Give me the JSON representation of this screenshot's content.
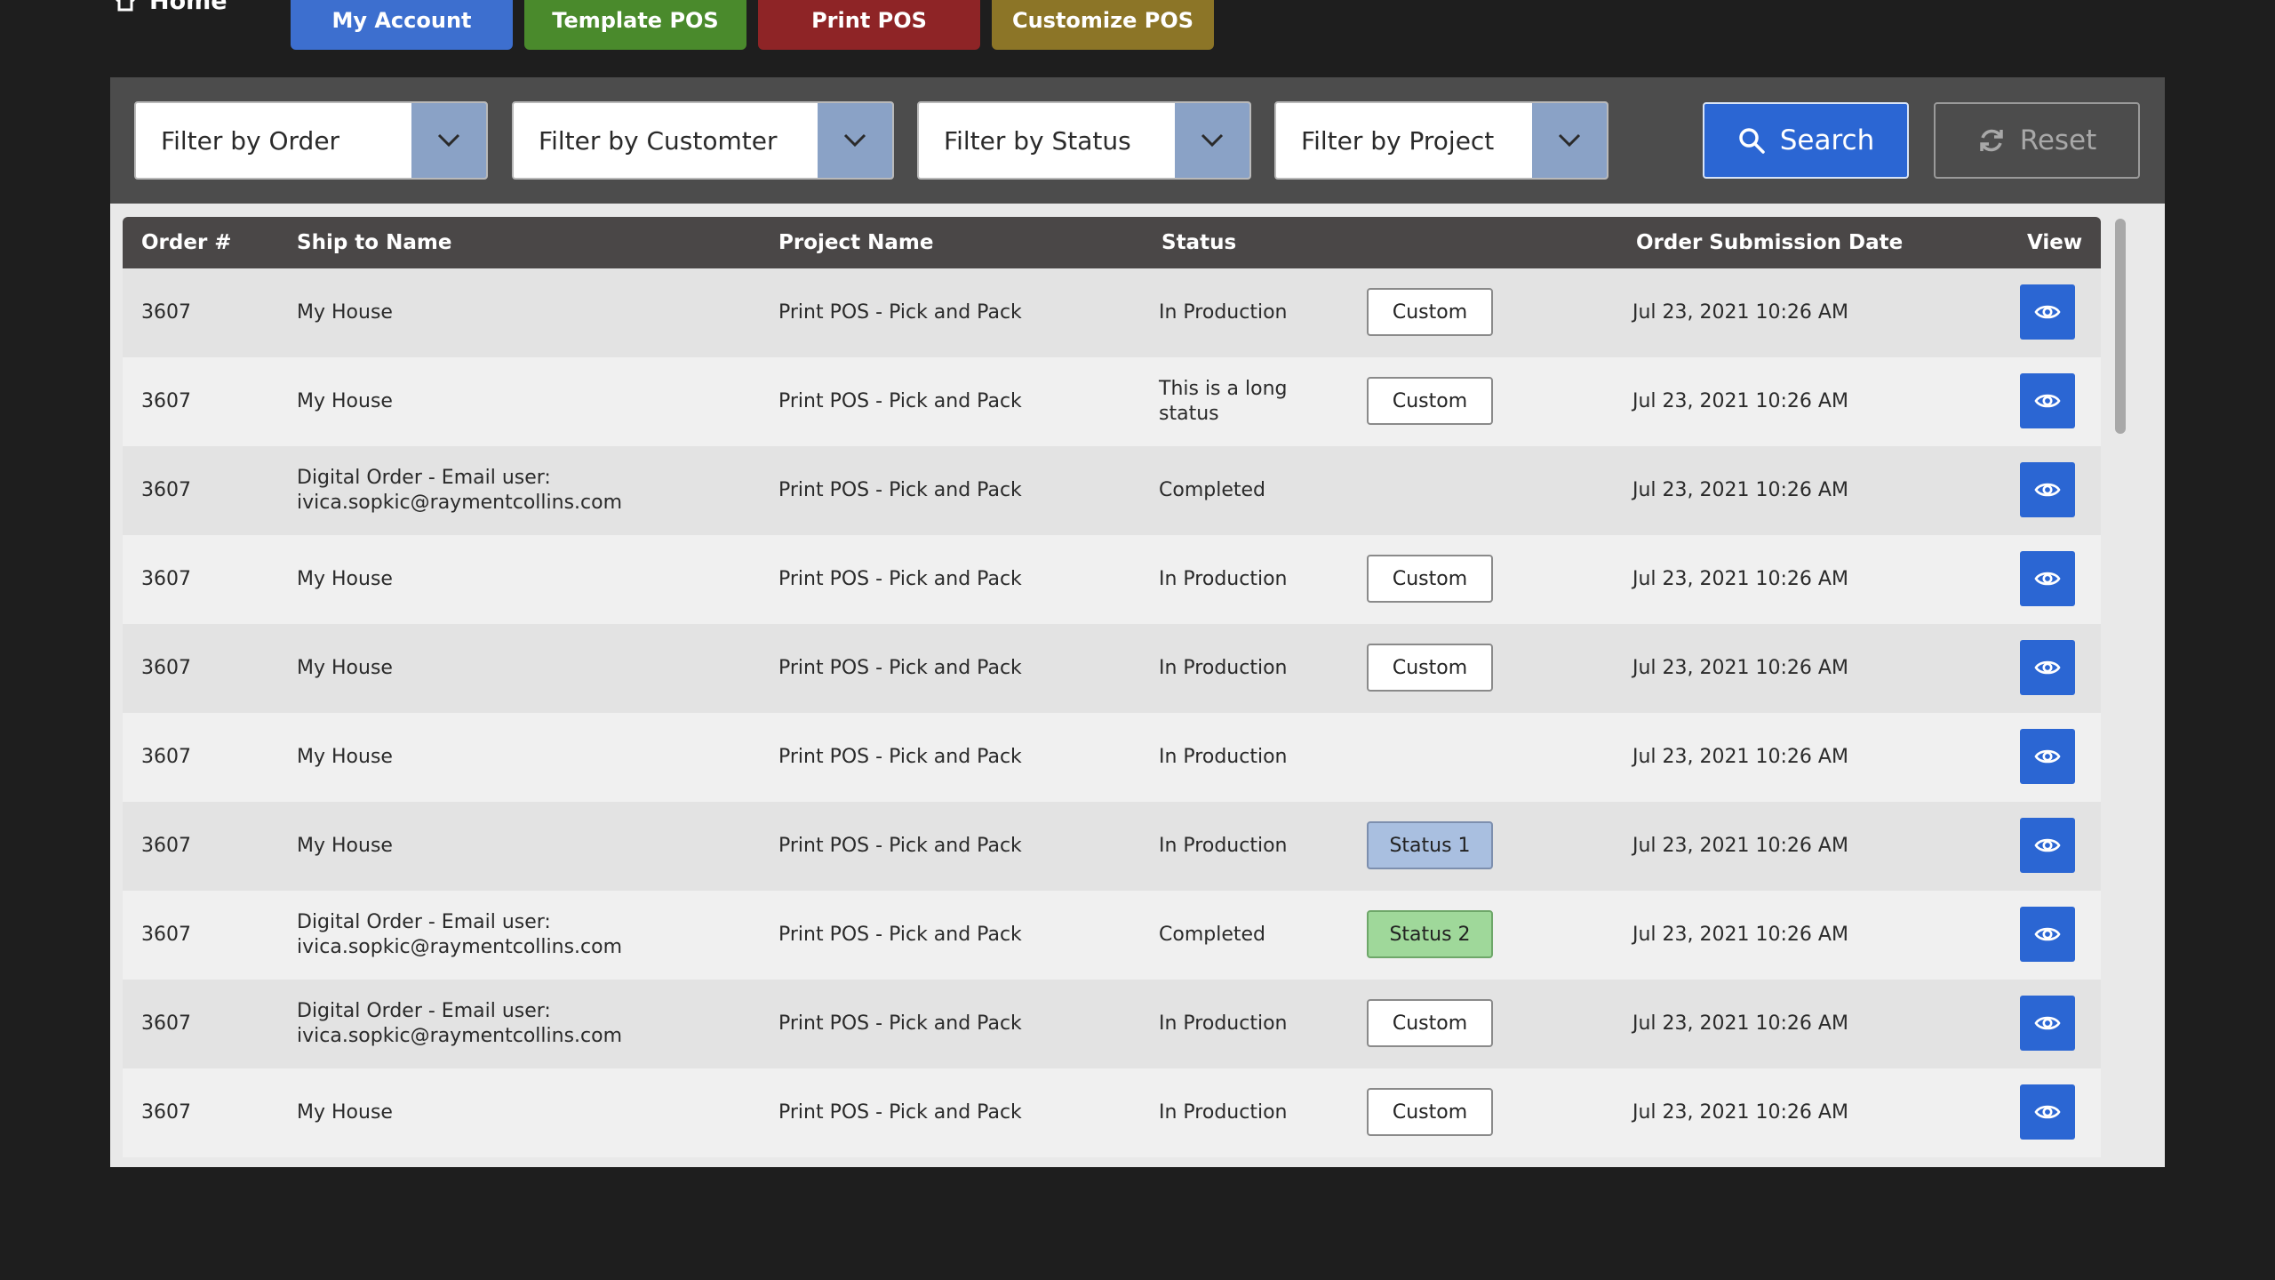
{
  "nav": {
    "home_label": "Home",
    "buttons": [
      {
        "label": "My Account",
        "color": "#3d6fcf"
      },
      {
        "label": "Template POS",
        "color": "#4a8a2c"
      },
      {
        "label": "Print POS",
        "color": "#8e2426"
      },
      {
        "label": "Customize POS",
        "color": "#8c7527"
      }
    ]
  },
  "filters": {
    "order": "Filter by Order",
    "customer": "Filter by Customter",
    "status": "Filter by Status",
    "project": "Filter by Project",
    "search_label": "Search",
    "reset_label": "Reset"
  },
  "table": {
    "headers": {
      "order": "Order #",
      "ship_to": "Ship to Name",
      "project": "Project Name",
      "status": "Status",
      "date": "Order Submission Date",
      "view": "View"
    },
    "rows": [
      {
        "order": "3607",
        "ship_to": "My House",
        "project": "Print POS  - Pick and Pack",
        "status": "In Production",
        "badge": "Custom",
        "badge_style": "custom",
        "date": "Jul 23, 2021 10:26 AM"
      },
      {
        "order": "3607",
        "ship_to": "My House",
        "project": "Print POS  - Pick and Pack",
        "status": "This is a long status",
        "badge": "Custom",
        "badge_style": "custom",
        "date": "Jul 23, 2021 10:26 AM"
      },
      {
        "order": "3607",
        "ship_to": "Digital Order - Email user: ivica.sopkic@raymentcollins.com",
        "project": "Print POS  - Pick and Pack",
        "status": "Completed",
        "badge": "",
        "badge_style": "none",
        "date": "Jul 23, 2021 10:26 AM"
      },
      {
        "order": "3607",
        "ship_to": "My House",
        "project": "Print POS  - Pick and Pack",
        "status": "In Production",
        "badge": "Custom",
        "badge_style": "custom",
        "date": "Jul 23, 2021 10:26 AM"
      },
      {
        "order": "3607",
        "ship_to": "My House",
        "project": "Print POS  - Pick and Pack",
        "status": "In Production",
        "badge": "Custom",
        "badge_style": "custom",
        "date": "Jul 23, 2021 10:26 AM"
      },
      {
        "order": "3607",
        "ship_to": "My House",
        "project": "Print POS  - Pick and Pack",
        "status": "In Production",
        "badge": "",
        "badge_style": "none",
        "date": "Jul 23, 2021 10:26 AM"
      },
      {
        "order": "3607",
        "ship_to": "My House",
        "project": "Print POS  - Pick and Pack",
        "status": "In Production",
        "badge": "Status 1",
        "badge_style": "status1",
        "date": "Jul 23, 2021 10:26 AM"
      },
      {
        "order": "3607",
        "ship_to": "Digital Order - Email user: ivica.sopkic@raymentcollins.com",
        "project": "Print POS  - Pick and Pack",
        "status": "Completed",
        "badge": "Status 2",
        "badge_style": "status2",
        "date": "Jul 23, 2021 10:26 AM"
      },
      {
        "order": "3607",
        "ship_to": "Digital Order - Email user: ivica.sopkic@raymentcollins.com",
        "project": "Print POS  - Pick and Pack",
        "status": "In Production",
        "badge": "Custom",
        "badge_style": "custom",
        "date": "Jul 23, 2021 10:26 AM"
      },
      {
        "order": "3607",
        "ship_to": "My House",
        "project": "Print POS  - Pick and Pack",
        "status": "In Production",
        "badge": "Custom",
        "badge_style": "custom",
        "date": "Jul 23, 2021 10:26 AM"
      }
    ]
  },
  "colors": {
    "accent": "#2b66d3",
    "status1": "#a9bfe0",
    "status2": "#9fd89a"
  },
  "icons": {
    "home": "home-icon",
    "dropdown": "chevron-down-icon",
    "search": "search-icon",
    "reset": "refresh-icon",
    "view": "eye-icon"
  }
}
